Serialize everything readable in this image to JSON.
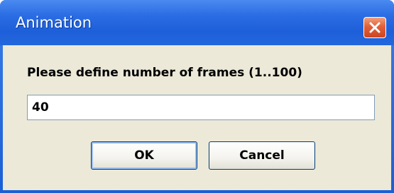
{
  "window": {
    "title": "Animation",
    "close_icon": "close-icon"
  },
  "dialog": {
    "prompt": "Please define number of frames (1..100)",
    "frames_value": "40",
    "ok_label": "OK",
    "cancel_label": "Cancel"
  },
  "colors": {
    "titlebar": "#2a6ce3",
    "client_background": "#ece9d8",
    "close_button": "#e0603a",
    "button_border": "#003c74"
  }
}
